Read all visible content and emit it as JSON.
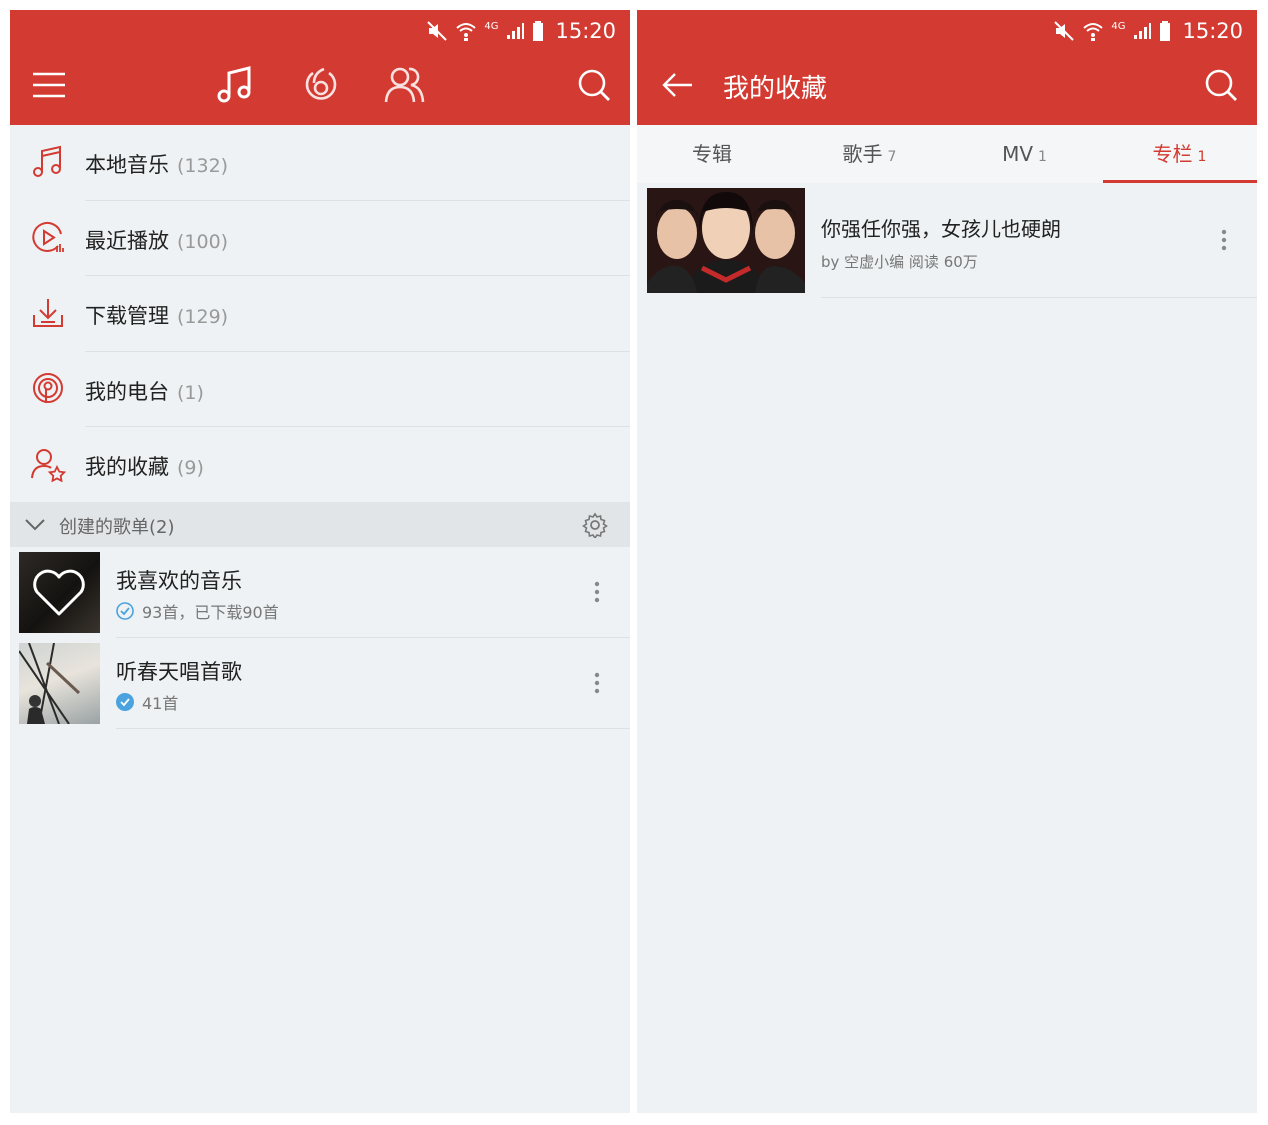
{
  "status_bar": {
    "time": "15:20",
    "network": "4G"
  },
  "left": {
    "menu_items": [
      {
        "label": "本地音乐",
        "count": "(132)",
        "icon": "music-note-icon"
      },
      {
        "label": "最近播放",
        "count": "(100)",
        "icon": "recent-play-icon"
      },
      {
        "label": "下载管理",
        "count": "(129)",
        "icon": "download-icon"
      },
      {
        "label": "我的电台",
        "count": "(1)",
        "icon": "radio-icon"
      },
      {
        "label": "我的收藏",
        "count": "(9)",
        "icon": "user-star-icon"
      }
    ],
    "section": {
      "label": "创建的歌单(2)"
    },
    "playlists": [
      {
        "name": "我喜欢的音乐",
        "subtitle": "93首，已下载90首"
      },
      {
        "name": "听春天唱首歌",
        "subtitle": "41首"
      }
    ]
  },
  "right": {
    "title": "我的收藏",
    "tabs": [
      {
        "label": "专辑",
        "count": ""
      },
      {
        "label": "歌手",
        "count": "7"
      },
      {
        "label": "MV",
        "count": "1"
      },
      {
        "label": "专栏",
        "count": "1"
      }
    ],
    "active_tab": 3,
    "items": [
      {
        "title": "你强任你强，女孩儿也硬朗",
        "subtitle": "by 空虚小编 阅读 60万"
      }
    ]
  },
  "colors": {
    "accent": "#d33a31",
    "background": "#eef2f4",
    "check": "#4aa3df"
  }
}
